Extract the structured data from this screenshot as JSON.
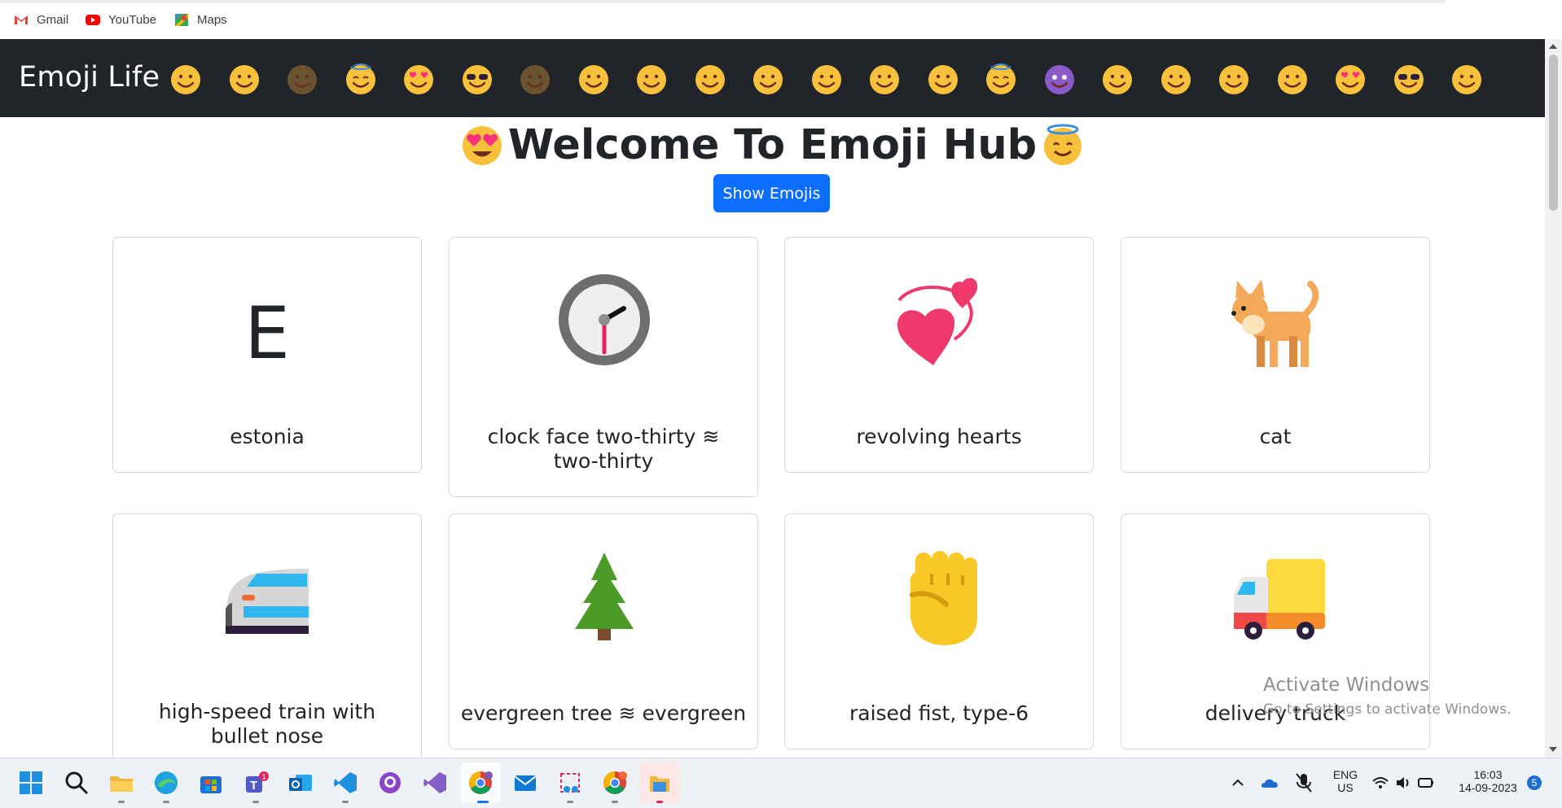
{
  "bookmarks": [
    {
      "label": "Gmail",
      "icon": "gmail-icon"
    },
    {
      "label": "YouTube",
      "icon": "youtube-icon"
    },
    {
      "label": "Maps",
      "icon": "maps-icon"
    }
  ],
  "navbar": {
    "brand": "Emoji Life",
    "emojis": [
      "smiling-face-icon",
      "face-savoring-food-icon",
      "relieved-face-dark-icon",
      "smiling-face-with-halo-icon",
      "heart-eyes-icon",
      "sunglasses-face-icon",
      "kissing-face-dark-icon",
      "grinning-face-icon",
      "beaming-face-icon",
      "tears-of-joy-icon",
      "grinning-big-eyes-icon",
      "grinning-smiling-eyes-icon",
      "grinning-sweat-icon",
      "squinting-face-icon",
      "smiling-face-with-halo-icon",
      "smiling-imp-icon",
      "winking-face-icon",
      "smiling-face-icon",
      "face-savoring-food-icon",
      "relieved-face-icon",
      "heart-eyes-icon",
      "sunglasses-face-icon",
      "smirking-face-icon"
    ]
  },
  "hero": {
    "title": "Welcome To Emoji Hub",
    "left_emoji": "heart-eyes-icon",
    "right_emoji": "smiling-face-with-halo-icon"
  },
  "show_button": {
    "label": "Show Emojis"
  },
  "cards": [
    {
      "title": "estonia",
      "glyph": "E",
      "icon": "estonia-letter"
    },
    {
      "title": "clock face two-thirty ≋ two-thirty",
      "icon": "clock-icon"
    },
    {
      "title": "revolving hearts",
      "icon": "revolving-hearts-icon"
    },
    {
      "title": "cat",
      "icon": "cat-icon"
    },
    {
      "title": "high-speed train with bullet nose",
      "icon": "bullet-train-icon"
    },
    {
      "title": "evergreen tree ≋ evergreen",
      "icon": "evergreen-tree-icon"
    },
    {
      "title": "raised fist, type-6",
      "icon": "raised-fist-icon"
    },
    {
      "title": "delivery truck",
      "icon": "delivery-truck-icon"
    }
  ],
  "watermark": {
    "line1": "Activate Windows",
    "line2": "Go to Settings to activate Windows."
  },
  "taskbar": {
    "apps": [
      "windows-start-icon",
      "search-icon",
      "file-explorer-icon",
      "edge-icon",
      "microsoft-store-icon",
      "teams-icon",
      "outlook-icon",
      "vscode-icon",
      "github-desktop-icon",
      "visual-studio-icon",
      "chrome-icon",
      "mail-icon",
      "snipping-tool-icon",
      "chrome-profile-icon",
      "file-explorer-folder-icon"
    ],
    "teams_badge": "1",
    "lang_line1": "ENG",
    "lang_line2": "US",
    "time": "16:03",
    "date": "14-09-2023",
    "notification_count": "5"
  },
  "colors": {
    "navbar_bg": "#212529",
    "button_bg": "#0d6efd",
    "emoji_yellow": "#f8c13c"
  }
}
